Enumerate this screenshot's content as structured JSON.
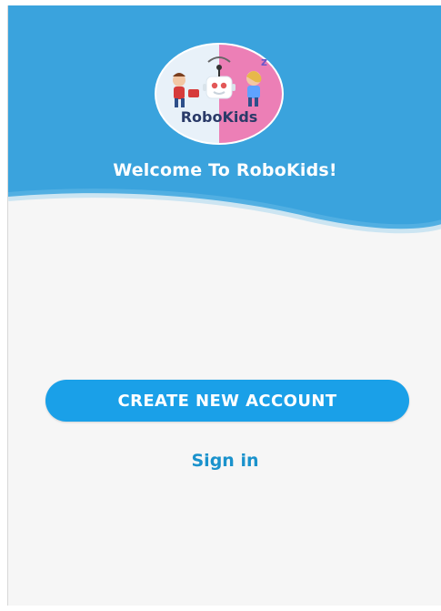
{
  "app": {
    "logo_text": "RoboKids",
    "welcome_title": "Welcome To RoboKids!"
  },
  "actions": {
    "create_account_label": "CREATE NEW ACCOUNT",
    "sign_in_label": "Sign in"
  },
  "colors": {
    "header_blue": "#3aa3dd",
    "button_blue": "#1aa0e8",
    "link_blue": "#1a92cc",
    "logo_pink": "#ec7fb6",
    "logo_light_blue": "#e8f1f9"
  }
}
